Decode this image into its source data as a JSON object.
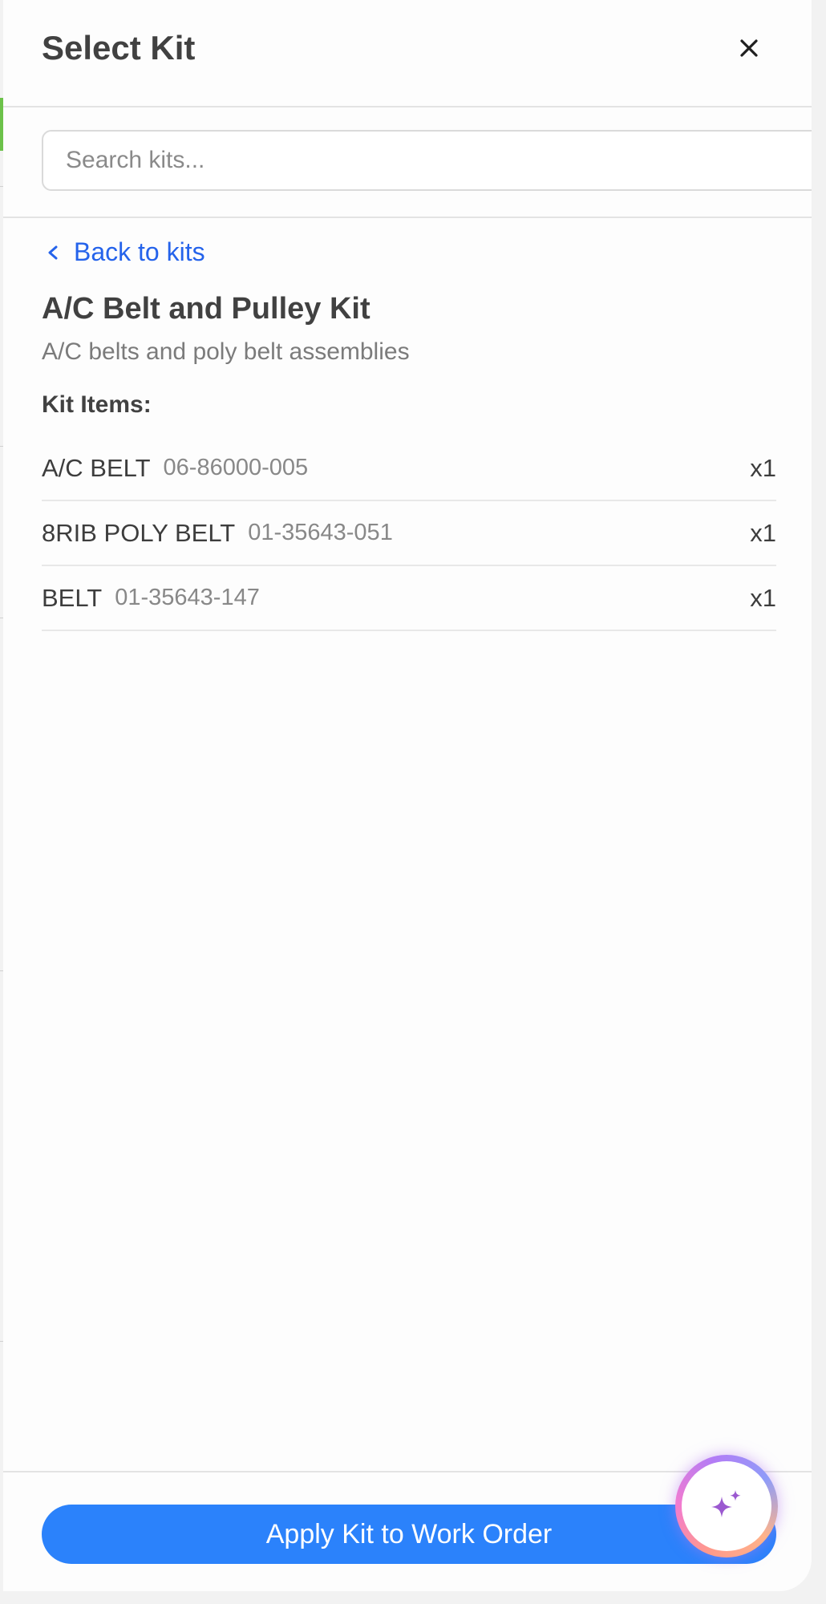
{
  "dialog": {
    "title": "Select Kit"
  },
  "search": {
    "placeholder": "Search kits...",
    "value": ""
  },
  "back_link": {
    "label": "Back to kits"
  },
  "kit": {
    "name": "A/C Belt and Pulley Kit",
    "description": "A/C belts and poly belt assemblies",
    "items_label": "Kit Items:",
    "items": [
      {
        "name": "A/C BELT",
        "part_number": "06-86000-005",
        "quantity": "x1"
      },
      {
        "name": "8RIB POLY BELT",
        "part_number": "01-35643-051",
        "quantity": "x1"
      },
      {
        "name": "BELT",
        "part_number": "01-35643-147",
        "quantity": "x1"
      }
    ]
  },
  "footer": {
    "apply_label": "Apply Kit to Work Order"
  },
  "icons": {
    "close": "close-icon",
    "back": "chevron-left-icon",
    "assistant": "sparkle-icon"
  },
  "colors": {
    "primary": "#2b82fb",
    "link": "#2563eb",
    "assistant_accent": "#9b59d0"
  }
}
